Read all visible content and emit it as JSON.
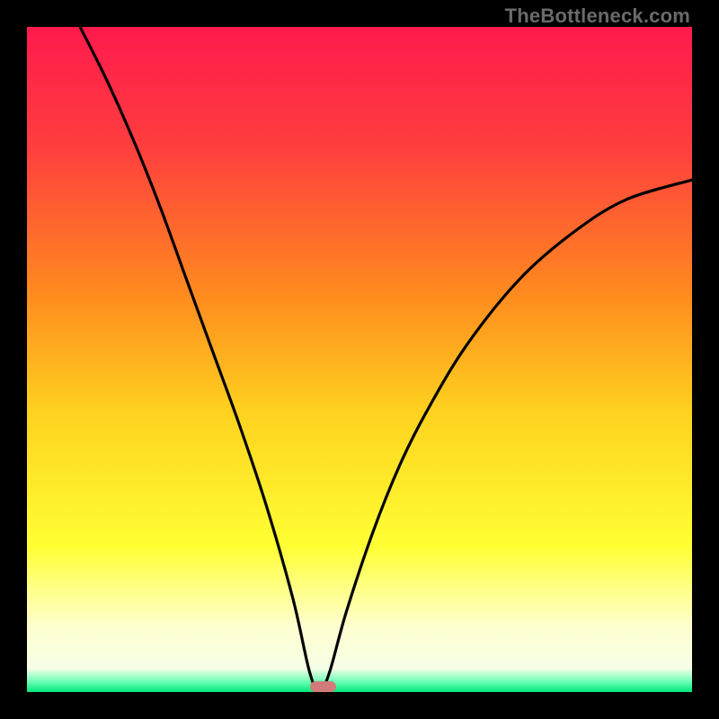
{
  "watermark": "TheBottleneck.com",
  "colors": {
    "bg_black": "#000000",
    "curve": "#000000",
    "marker": "#d17a7a",
    "watermark": "#6a6a6a",
    "gradient_stops": [
      {
        "offset": 0.0,
        "color": "#ff1a4d"
      },
      {
        "offset": 0.18,
        "color": "#ff3e3e"
      },
      {
        "offset": 0.4,
        "color": "#ff8a1f"
      },
      {
        "offset": 0.58,
        "color": "#ffd21f"
      },
      {
        "offset": 0.78,
        "color": "#ffff33"
      },
      {
        "offset": 0.9,
        "color": "#ffffcf"
      },
      {
        "offset": 0.965,
        "color": "#f6ffe6"
      },
      {
        "offset": 0.985,
        "color": "#66ffb3"
      },
      {
        "offset": 1.0,
        "color": "#00e67a"
      }
    ]
  },
  "chart_data": {
    "type": "line",
    "title": "",
    "xlabel": "",
    "ylabel": "",
    "xlim": [
      0,
      1
    ],
    "ylim": [
      0,
      1
    ],
    "notch_x": 0.44,
    "marker": {
      "x_start": 0.425,
      "x_end": 0.465,
      "y": 0.0
    },
    "series": [
      {
        "name": "bottleneck-curve",
        "note": "V-shaped curve touching y=0 near x≈0.44; estimated from pixels",
        "x": [
          0.08,
          0.12,
          0.16,
          0.2,
          0.24,
          0.28,
          0.32,
          0.36,
          0.4,
          0.425,
          0.44,
          0.455,
          0.48,
          0.52,
          0.56,
          0.6,
          0.66,
          0.74,
          0.82,
          0.9,
          1.0
        ],
        "y": [
          1.0,
          0.92,
          0.83,
          0.73,
          0.62,
          0.51,
          0.4,
          0.28,
          0.14,
          0.03,
          0.0,
          0.03,
          0.12,
          0.24,
          0.34,
          0.42,
          0.52,
          0.62,
          0.69,
          0.74,
          0.77
        ]
      }
    ]
  }
}
